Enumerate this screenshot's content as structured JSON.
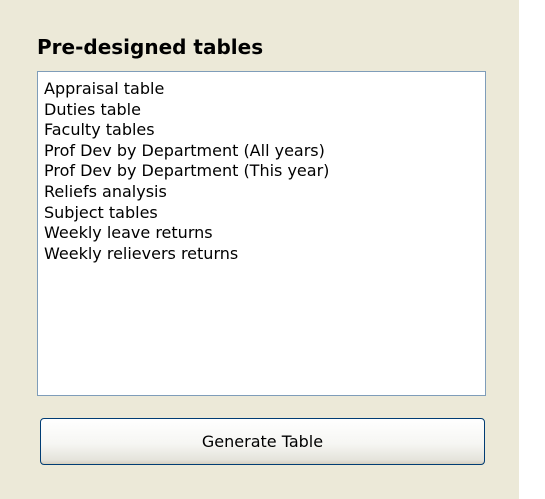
{
  "panel": {
    "title": "Pre-designed tables",
    "list_items": [
      "Appraisal table",
      "Duties table",
      "Faculty tables",
      "Prof Dev by Department (All years)",
      "Prof Dev by Department (This year)",
      "Reliefs analysis",
      "Subject tables",
      "Weekly leave returns",
      "Weekly relievers returns"
    ],
    "generate_button_label": "Generate Table"
  },
  "colors": {
    "panel_background": "#ece9d8",
    "listbox_border": "#7f9db9",
    "button_border": "#003c74"
  }
}
